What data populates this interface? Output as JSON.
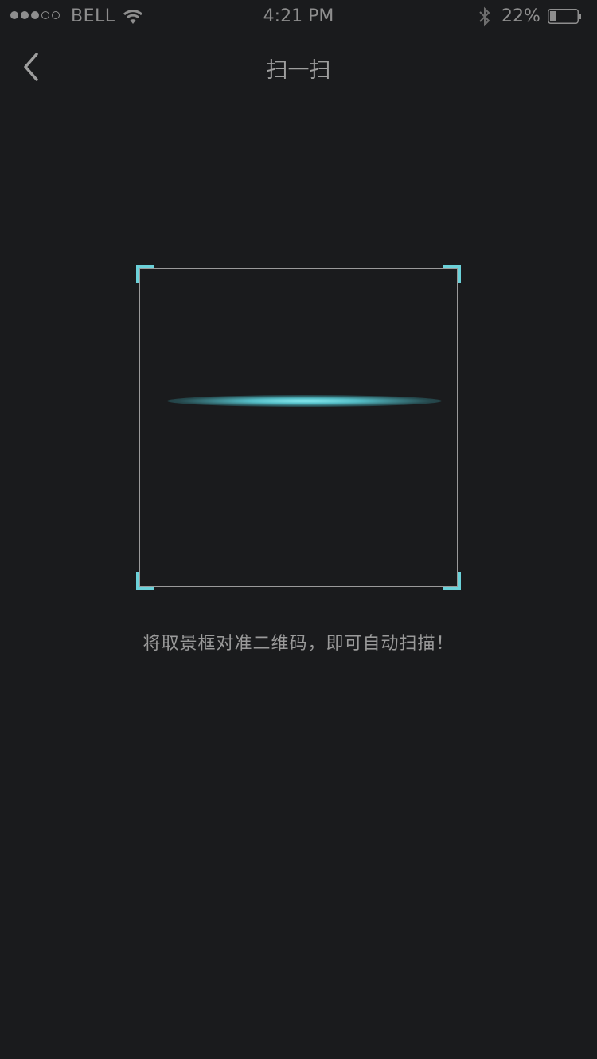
{
  "status_bar": {
    "signal_filled": 3,
    "signal_total": 5,
    "carrier": "BELL",
    "time": "4:21 PM",
    "battery_percent_text": "22%",
    "battery_level": 0.22,
    "icons": [
      "wifi-icon",
      "bluetooth-icon",
      "battery-icon"
    ]
  },
  "nav": {
    "back_icon": "chevron-left-icon",
    "title": "扫一扫"
  },
  "scanner": {
    "accent_color": "#6bd1d9",
    "hint": "将取景框对准二维码，即可自动扫描！"
  }
}
